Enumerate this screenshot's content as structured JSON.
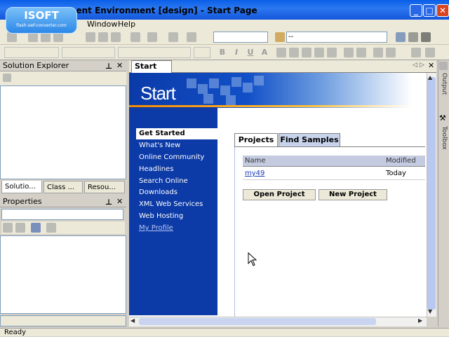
{
  "app": {
    "title": "ment Environment [design] - Start Page",
    "logo_text": "ISOFT",
    "logo_sub": "flash-swf-converter.com",
    "minimize": "_",
    "maximize": "□",
    "close": "✕"
  },
  "menu": {
    "items": [
      "Window",
      "Help"
    ],
    "partial": "s"
  },
  "toolbar2": {
    "bold": "B",
    "italic": "I",
    "underline": "U",
    "font_color": "A",
    "find_value": "--"
  },
  "solution_explorer": {
    "title": "Solution Explorer",
    "pin": "📌",
    "close": "✕",
    "tabs": [
      "Solutio...",
      "Class ...",
      "Resou..."
    ]
  },
  "properties": {
    "title": "Properties",
    "pin": "📌",
    "close": "✕"
  },
  "document": {
    "tab_label": "Start Page",
    "banner_title": "Start",
    "nav": {
      "selected": "Get Started",
      "items": [
        "What's New",
        "Online Community",
        "Headlines",
        "Search Online",
        "Downloads",
        "XML Web Services",
        "Web Hosting",
        "My Profile"
      ]
    },
    "tabs": [
      "Projects",
      "Find Samples"
    ],
    "table": {
      "headers": [
        "Name",
        "Modified"
      ],
      "rows": [
        {
          "name": "my49",
          "modified": "Today"
        }
      ]
    },
    "buttons": {
      "open": "Open Project",
      "new": "New Project"
    }
  },
  "side_labels": {
    "output": "Output",
    "toolbox": "Toolbox"
  },
  "status": {
    "text": "Ready"
  },
  "colors": {
    "title_blue": "#0a5ee8",
    "nav_blue": "#0c3aa6",
    "accent_orange": "#f28a00"
  }
}
